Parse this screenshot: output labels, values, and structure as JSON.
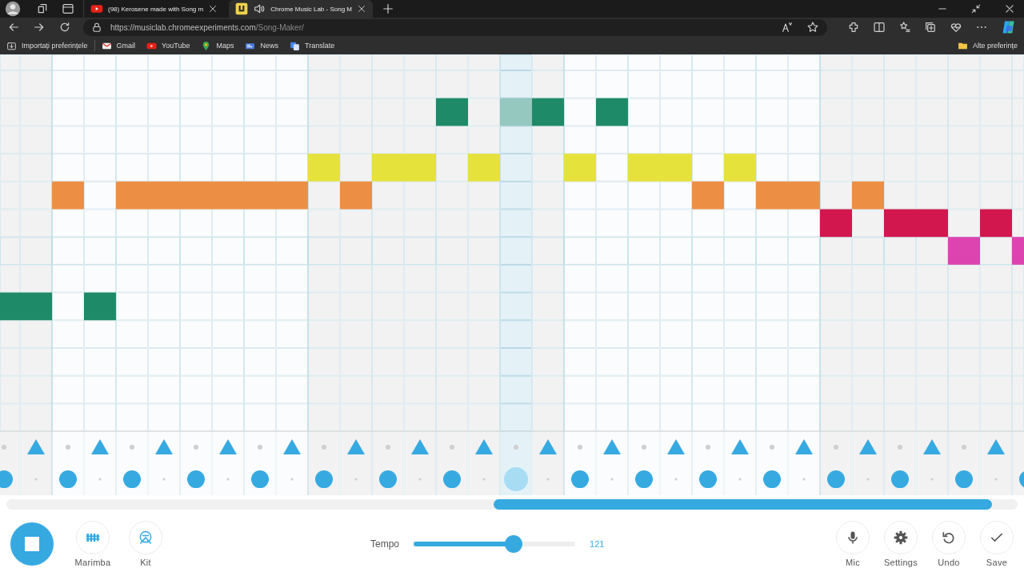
{
  "browser": {
    "tabs": [
      {
        "kind": "youtube",
        "title": "(98) Kerosene made with Song m",
        "selected": false,
        "audio": false
      },
      {
        "kind": "musiclab",
        "title": "Chrome Music Lab - Song M",
        "selected": true,
        "audio": true
      }
    ],
    "url": {
      "host": "https://musiclab.chromeexperiments.com",
      "path": "/Song-Maker/"
    },
    "bookmarks": [
      {
        "kind": "import",
        "label": "Importați preferințele"
      },
      {
        "kind": "gmail",
        "label": "Gmail"
      },
      {
        "kind": "youtube",
        "label": "YouTube"
      },
      {
        "kind": "maps",
        "label": "Maps"
      },
      {
        "kind": "news",
        "label": "News"
      },
      {
        "kind": "translate",
        "label": "Translate"
      }
    ],
    "other_bookmarks": "Alte preferințe"
  },
  "melody_rows": [
    {
      "notes": [
        false,
        false,
        false,
        false,
        false,
        false,
        false,
        false,
        false,
        false,
        false,
        false,
        false,
        false,
        false,
        false,
        false,
        false,
        false,
        false,
        false,
        false,
        false,
        false,
        false,
        false,
        false,
        false,
        false,
        false,
        false,
        false,
        false
      ]
    },
    {
      "notes": [
        false,
        false,
        false,
        false,
        false,
        false,
        false,
        false,
        false,
        false,
        false,
        false,
        false,
        false,
        false,
        false,
        false,
        false,
        false,
        false,
        false,
        false,
        false,
        false,
        false,
        false,
        false,
        false,
        false,
        false,
        false,
        false,
        false
      ]
    },
    {
      "color": "#1f8a68",
      "notes": [
        false,
        false,
        false,
        false,
        false,
        false,
        false,
        false,
        false,
        false,
        false,
        false,
        false,
        false,
        true,
        false,
        true,
        true,
        false,
        true,
        false,
        false,
        false,
        false,
        false,
        false,
        false,
        false,
        false,
        false,
        false,
        false,
        false
      ]
    },
    {
      "notes": [
        false,
        false,
        false,
        false,
        false,
        false,
        false,
        false,
        false,
        false,
        false,
        false,
        false,
        false,
        false,
        false,
        false,
        false,
        false,
        false,
        false,
        false,
        false,
        false,
        false,
        false,
        false,
        false,
        false,
        false,
        false,
        false,
        false
      ]
    },
    {
      "color": "#e6e23c",
      "notes": [
        false,
        false,
        false,
        false,
        false,
        false,
        false,
        false,
        false,
        false,
        true,
        false,
        true,
        true,
        false,
        true,
        false,
        false,
        true,
        false,
        true,
        true,
        false,
        true,
        false,
        false,
        false,
        false,
        false,
        false,
        false,
        false,
        false
      ]
    },
    {
      "color": "#ec8f45",
      "notes": [
        false,
        false,
        true,
        false,
        true,
        true,
        true,
        true,
        true,
        true,
        false,
        true,
        false,
        false,
        false,
        false,
        false,
        false,
        false,
        false,
        false,
        false,
        true,
        false,
        true,
        true,
        false,
        true,
        false,
        false,
        false,
        false,
        false
      ]
    },
    {
      "color": "#d2174f",
      "notes": [
        false,
        false,
        false,
        false,
        false,
        false,
        false,
        false,
        false,
        false,
        false,
        false,
        false,
        false,
        false,
        false,
        false,
        false,
        false,
        false,
        false,
        false,
        false,
        false,
        false,
        false,
        true,
        false,
        true,
        true,
        false,
        true,
        false
      ]
    },
    {
      "color": "#dd44b0",
      "notes": [
        false,
        false,
        false,
        false,
        false,
        false,
        false,
        false,
        false,
        false,
        false,
        false,
        false,
        false,
        false,
        false,
        false,
        false,
        false,
        false,
        false,
        false,
        false,
        false,
        false,
        false,
        false,
        false,
        false,
        false,
        true,
        false,
        true
      ]
    },
    {
      "notes": [
        false,
        false,
        false,
        false,
        false,
        false,
        false,
        false,
        false,
        false,
        false,
        false,
        false,
        false,
        false,
        false,
        false,
        false,
        false,
        false,
        false,
        false,
        false,
        false,
        false,
        false,
        false,
        false,
        false,
        false,
        false,
        false,
        false
      ]
    },
    {
      "color": "#1f8a68",
      "notes": [
        true,
        true,
        false,
        true,
        false,
        false,
        false,
        false,
        false,
        false,
        false,
        false,
        false,
        false,
        false,
        false,
        false,
        false,
        false,
        false,
        false,
        false,
        false,
        false,
        false,
        false,
        false,
        false,
        false,
        false,
        false,
        false,
        false
      ]
    },
    {
      "notes": [
        false,
        false,
        false,
        false,
        false,
        false,
        false,
        false,
        false,
        false,
        false,
        false,
        false,
        false,
        false,
        false,
        false,
        false,
        false,
        false,
        false,
        false,
        false,
        false,
        false,
        false,
        false,
        false,
        false,
        false,
        false,
        false,
        false
      ]
    },
    {
      "notes": [
        false,
        false,
        false,
        false,
        false,
        false,
        false,
        false,
        false,
        false,
        false,
        false,
        false,
        false,
        false,
        false,
        false,
        false,
        false,
        false,
        false,
        false,
        false,
        false,
        false,
        false,
        false,
        false,
        false,
        false,
        false,
        false,
        false
      ]
    },
    {
      "notes": [
        false,
        false,
        false,
        false,
        false,
        false,
        false,
        false,
        false,
        false,
        false,
        false,
        false,
        false,
        false,
        false,
        false,
        false,
        false,
        false,
        false,
        false,
        false,
        false,
        false,
        false,
        false,
        false,
        false,
        false,
        false,
        false,
        false
      ]
    },
    {
      "notes": [
        false,
        false,
        false,
        false,
        false,
        false,
        false,
        false,
        false,
        false,
        false,
        false,
        false,
        false,
        false,
        false,
        false,
        false,
        false,
        false,
        false,
        false,
        false,
        false,
        false,
        false,
        false,
        false,
        false,
        false,
        false,
        false,
        false
      ]
    }
  ],
  "steps": [
    {
      "playing": false,
      "triangle": false,
      "circle": true
    },
    {
      "playing": false,
      "triangle": true,
      "circle": false
    },
    {
      "playing": false,
      "triangle": false,
      "circle": true
    },
    {
      "playing": false,
      "triangle": true,
      "circle": false
    },
    {
      "playing": false,
      "triangle": false,
      "circle": true
    },
    {
      "playing": false,
      "triangle": true,
      "circle": false
    },
    {
      "playing": false,
      "triangle": false,
      "circle": true
    },
    {
      "playing": false,
      "triangle": true,
      "circle": false
    },
    {
      "playing": false,
      "triangle": false,
      "circle": true
    },
    {
      "playing": false,
      "triangle": true,
      "circle": false
    },
    {
      "playing": false,
      "triangle": false,
      "circle": true
    },
    {
      "playing": false,
      "triangle": true,
      "circle": false
    },
    {
      "playing": false,
      "triangle": false,
      "circle": true
    },
    {
      "playing": false,
      "triangle": true,
      "circle": false
    },
    {
      "playing": false,
      "triangle": false,
      "circle": true
    },
    {
      "playing": false,
      "triangle": true,
      "circle": false
    },
    {
      "playing": true,
      "triangle": false,
      "circle": true
    },
    {
      "playing": false,
      "triangle": true,
      "circle": false
    },
    {
      "playing": false,
      "triangle": false,
      "circle": true
    },
    {
      "playing": false,
      "triangle": true,
      "circle": false
    },
    {
      "playing": false,
      "triangle": false,
      "circle": true
    },
    {
      "playing": false,
      "triangle": true,
      "circle": false
    },
    {
      "playing": false,
      "triangle": false,
      "circle": true
    },
    {
      "playing": false,
      "triangle": true,
      "circle": false
    },
    {
      "playing": false,
      "triangle": false,
      "circle": true
    },
    {
      "playing": false,
      "triangle": true,
      "circle": false
    },
    {
      "playing": false,
      "triangle": false,
      "circle": true
    },
    {
      "playing": false,
      "triangle": true,
      "circle": false
    },
    {
      "playing": false,
      "triangle": false,
      "circle": true
    },
    {
      "playing": false,
      "triangle": true,
      "circle": false
    },
    {
      "playing": false,
      "triangle": false,
      "circle": true
    },
    {
      "playing": false,
      "triangle": true,
      "circle": false
    },
    {
      "playing": false,
      "circle": true
    }
  ],
  "controls": {
    "playing": true,
    "instruments": [
      {
        "kind": "marimba",
        "label": "Marimba"
      },
      {
        "kind": "kit",
        "label": "Kit"
      }
    ],
    "tempo": {
      "label": "Tempo",
      "level": 0.62,
      "reading": "121"
    },
    "tools": [
      {
        "kind": "mic",
        "label": "Mic"
      },
      {
        "kind": "settings",
        "label": "Settings"
      },
      {
        "kind": "undo",
        "label": "Undo"
      },
      {
        "kind": "save",
        "label": "Save"
      }
    ]
  }
}
